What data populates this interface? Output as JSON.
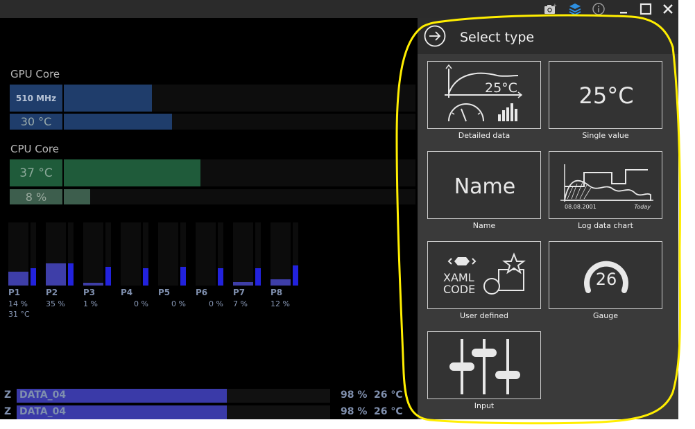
{
  "colors": {
    "gpu_bar": "#1f3d6b",
    "cpu_bar": "#1f5b3a",
    "core_bar": "#3e3ea8",
    "panel_bg": "#3a3a3a",
    "highlight": "#ffee00"
  },
  "titlebar": {
    "icons": [
      "camera-icon",
      "layers-icon",
      "info-icon",
      "minimize-icon",
      "maximize-icon",
      "close-icon"
    ]
  },
  "gpu": {
    "title": "GPU Core",
    "clock_label": "510 MHz",
    "clock_level": 0.35,
    "temp_label": "30 °C",
    "temp_level": 0.4
  },
  "cpu": {
    "title": "CPU Core",
    "temp_label": "37 °C",
    "temp_level": 0.47,
    "load_label": "8 %",
    "load_level": 0.08
  },
  "cores": [
    {
      "name": "P1",
      "pct": "14 %",
      "level": 0.22,
      "thin": 0.28
    },
    {
      "name": "P2",
      "pct": "35 %",
      "level": 0.35,
      "thin": 0.35
    },
    {
      "name": "P3",
      "pct": "1 %",
      "level": 0.04,
      "thin": 0.3
    },
    {
      "name": "P4",
      "pct": "0 %",
      "level": 0.0,
      "thin": 0.28
    },
    {
      "name": "P5",
      "pct": "0 %",
      "level": 0.0,
      "thin": 0.3
    },
    {
      "name": "P6",
      "pct": "0 %",
      "level": 0.0,
      "thin": 0.28
    },
    {
      "name": "P7",
      "pct": "7 %",
      "level": 0.06,
      "thin": 0.28
    },
    {
      "name": "P8",
      "pct": "12 %",
      "level": 0.1,
      "thin": 0.32
    }
  ],
  "core_temp": "31 °C",
  "data_rows": [
    {
      "z": "Z",
      "name": "DATA_04",
      "pct": "98 %",
      "temp": "26 °C"
    },
    {
      "z": "Z",
      "name": "DATA_04",
      "pct": "98 %",
      "temp": "26 °C"
    }
  ],
  "panel": {
    "title": "Select type",
    "tiles": [
      {
        "label": "Detailed data",
        "icon": "detailed-data-icon",
        "text": "25°C"
      },
      {
        "label": "Single value",
        "icon": "single-value-icon",
        "text": "25°C"
      },
      {
        "label": "Name",
        "icon": "name-icon",
        "text": "Name"
      },
      {
        "label": "Log data chart",
        "icon": "log-chart-icon",
        "date_left": "08.08.2001",
        "date_right": "Today"
      },
      {
        "label": "User defined",
        "icon": "user-defined-icon",
        "line1": "XAML",
        "line2": "CODE"
      },
      {
        "label": "Gauge",
        "icon": "gauge-icon",
        "text": "26"
      },
      {
        "label": "Input",
        "icon": "sliders-icon"
      }
    ]
  }
}
